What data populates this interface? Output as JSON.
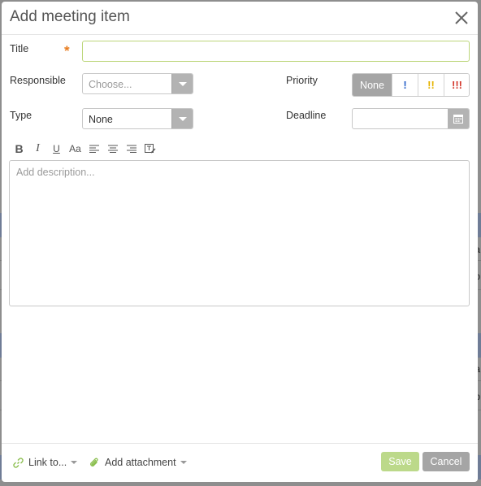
{
  "dialog": {
    "title": "Add meeting item"
  },
  "form": {
    "title_label": "Title",
    "required_mark": "*",
    "title_value": "",
    "responsible_label": "Responsible",
    "responsible_placeholder": "Choose...",
    "priority_label": "Priority",
    "priority_options": [
      "None",
      "!",
      "!!",
      "!!!"
    ],
    "priority_selected": "None",
    "type_label": "Type",
    "type_value": "None",
    "deadline_label": "Deadline",
    "deadline_value": ""
  },
  "editor": {
    "toolbar": {
      "bold": "B",
      "italic": "I",
      "underline": "U",
      "font_size": "Aa"
    },
    "placeholder": "Add description..."
  },
  "footer": {
    "link_label": "Link to...",
    "attachment_label": "Add attachment",
    "save_label": "Save",
    "cancel_label": "Cancel"
  },
  "colors": {
    "required": "#e87c1e",
    "save_button": "#bcd98a",
    "cancel_button": "#a5a5a5",
    "priority_1": "#2b63c9",
    "priority_2": "#e6b400",
    "priority_3": "#d43a2f"
  },
  "background": {
    "fragments": [
      "ta",
      "p",
      "ta",
      "p"
    ]
  }
}
